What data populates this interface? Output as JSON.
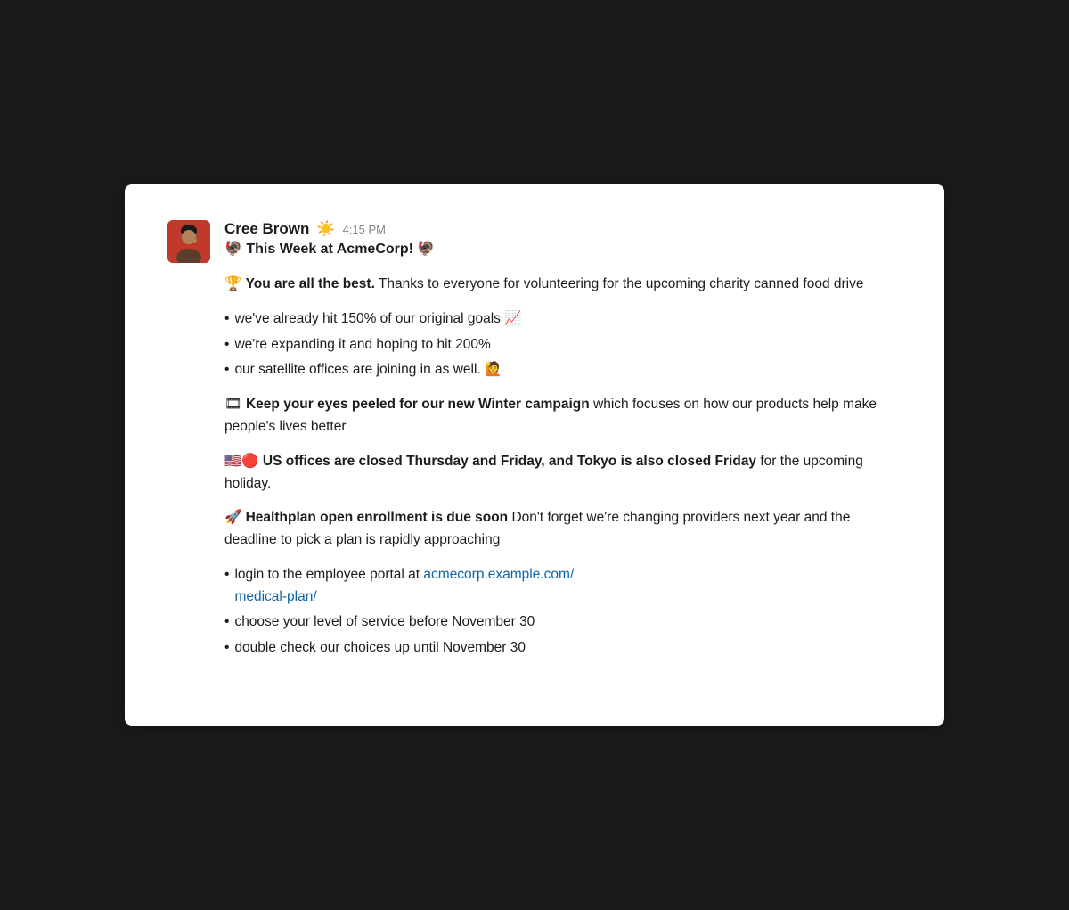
{
  "card": {
    "user": {
      "name": "Cree Brown",
      "emoji_status": "☀️",
      "timestamp": "4:15 PM"
    },
    "channel_header": "🦃 This Week at AcmeCorp! 🦃",
    "paragraphs": [
      {
        "id": "charity",
        "emoji": "🏆",
        "bold_text": "You are all the best.",
        "text": " Thanks to everyone for volunteering for the upcoming charity canned food drive"
      },
      {
        "id": "winter",
        "emoji": "🎞",
        "bold_text": "Keep your eyes peeled for our new Winter campaign",
        "text": " which focuses on how our products help make people's lives better"
      },
      {
        "id": "offices",
        "emoji": "🇺🇸🔴",
        "bold_text": "US offices are closed Thursday and Friday, and Tokyo is also closed Friday",
        "text": " for the upcoming holiday."
      },
      {
        "id": "health",
        "emoji": "🚀",
        "bold_text": "Healthplan open enrollment is due soon",
        "text": " Don't forget we're changing providers next year and the deadline to pick a plan is rapidly approaching"
      }
    ],
    "bullets_charity": [
      "we've already hit 150% of our original goals 📈",
      "we're expanding it and hoping to hit 200%",
      "our satellite offices are joining in as well. 🙋"
    ],
    "bullets_health": [
      {
        "text_before": "login to the employee portal at ",
        "link_text": "acmecorp.example.com/medical-plan/",
        "link_url": "acmecorp.example.com/medical-plan/",
        "text_after": ""
      },
      {
        "text": "choose your level of service before November 30",
        "link_text": null
      },
      {
        "text": "double check our choices up until November 30",
        "link_text": null
      }
    ],
    "link": {
      "text": "acmecorp.example.com/medical-plan/",
      "url": "acmecorp.example.com/medical-plan/"
    }
  }
}
